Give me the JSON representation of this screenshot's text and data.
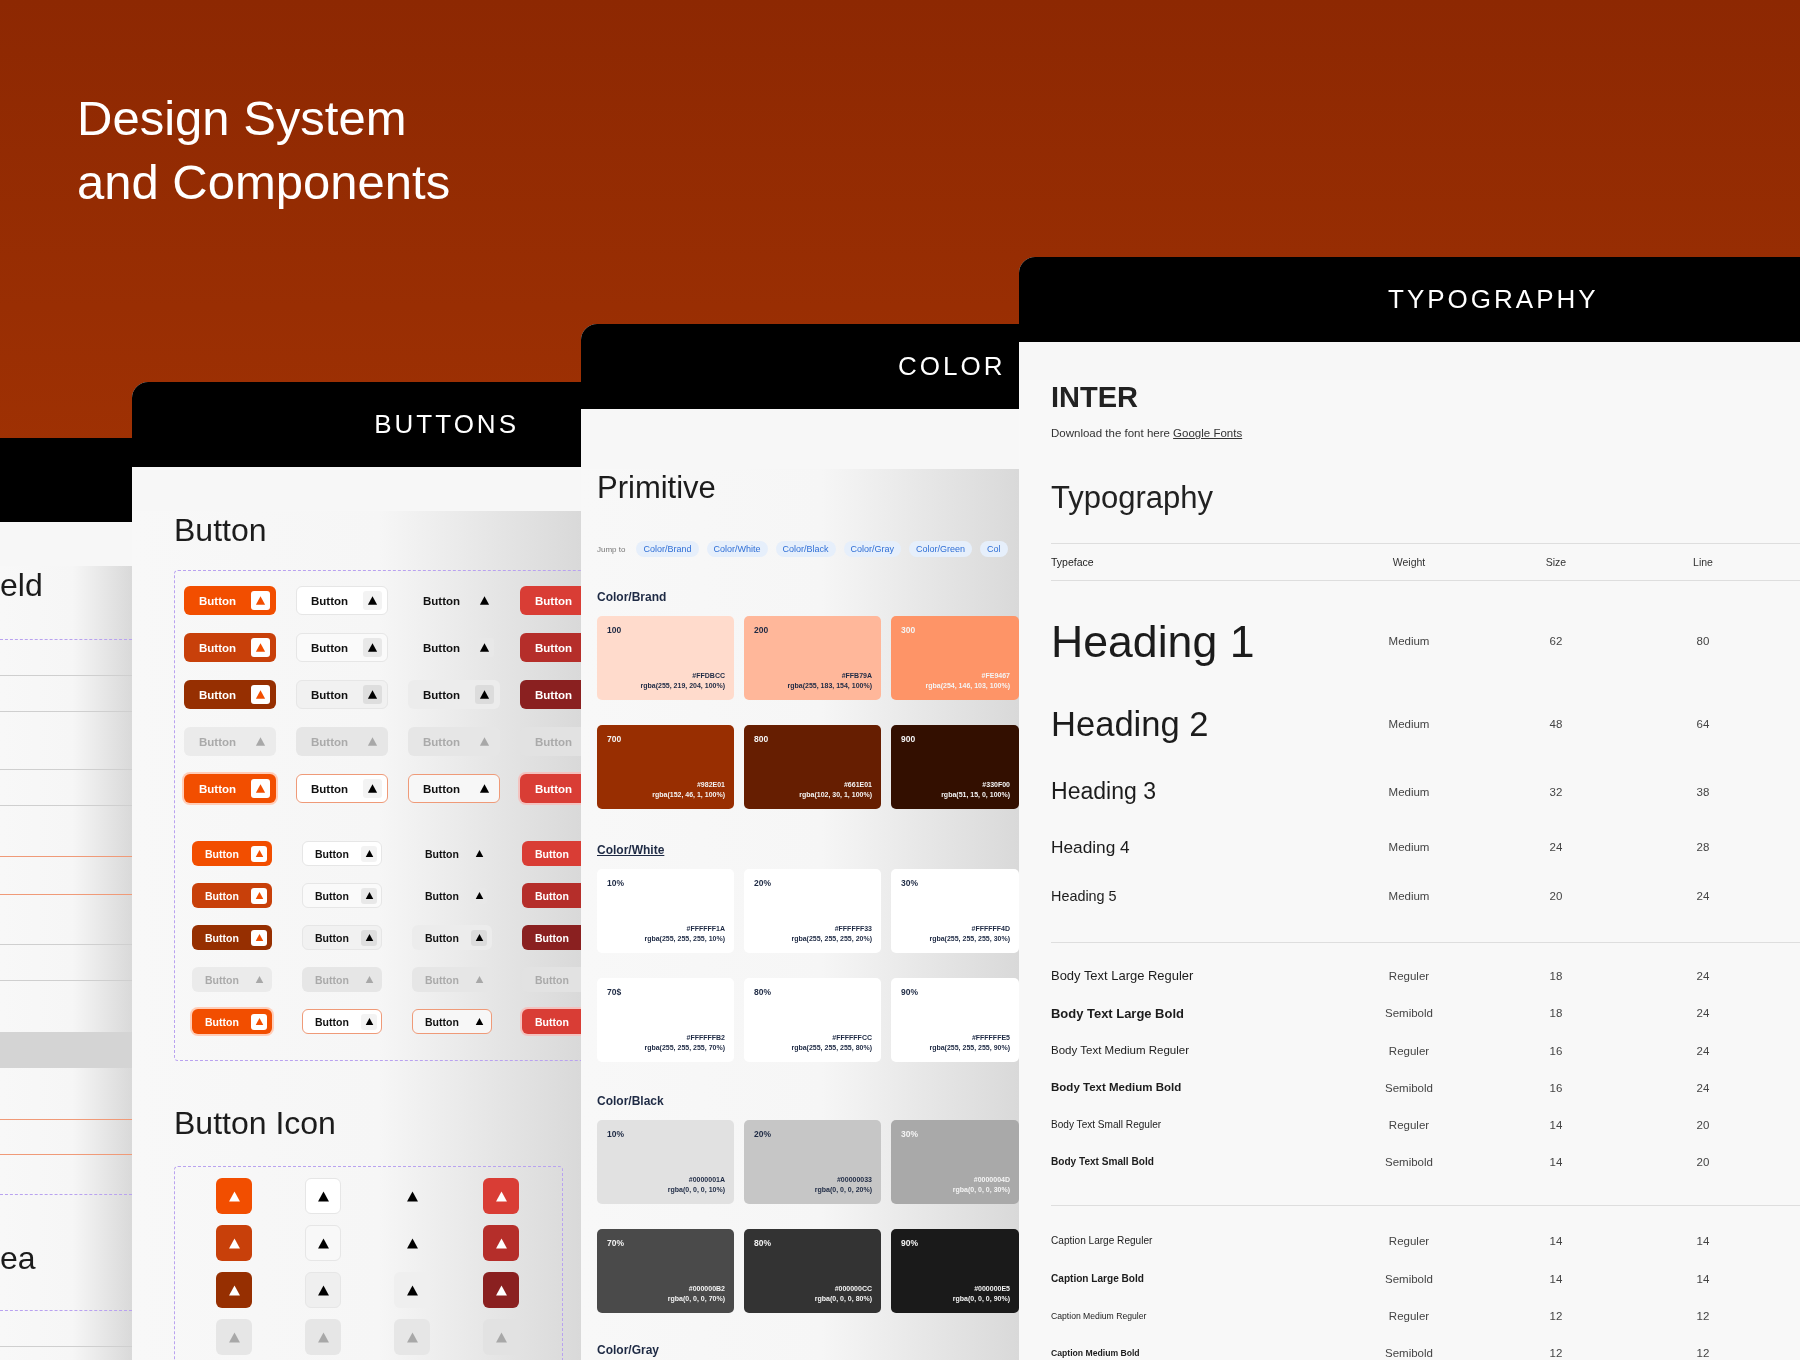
{
  "headline": [
    "Design System",
    "and Components"
  ],
  "field_card": {
    "heading_fragment": "eld",
    "area_fragment": "ea"
  },
  "buttons_card": {
    "title": "BUTTONS",
    "button_heading": "Button",
    "button_sets": [
      {
        "kind": "medium",
        "rows": [
          {
            "kind": "default",
            "buttons": [
              {
                "kind": "primary",
                "label": "Button"
              },
              {
                "kind": "secondary",
                "label": "Button"
              },
              {
                "kind": "tertiary",
                "label": "Button"
              },
              {
                "kind": "danger",
                "label": "Button"
              }
            ]
          },
          {
            "kind": "hover",
            "buttons": [
              {
                "kind": "primary",
                "label": "Button"
              },
              {
                "kind": "secondary",
                "label": "Button"
              },
              {
                "kind": "tertiary",
                "label": "Button"
              },
              {
                "kind": "danger",
                "label": "Button"
              }
            ]
          },
          {
            "kind": "pressed",
            "buttons": [
              {
                "kind": "primary",
                "label": "Button"
              },
              {
                "kind": "secondary",
                "label": "Button"
              },
              {
                "kind": "tertiary",
                "label": "Button"
              },
              {
                "kind": "danger",
                "label": "Button"
              }
            ]
          },
          {
            "kind": "disabled",
            "buttons": [
              {
                "kind": "primary",
                "label": "Button"
              },
              {
                "kind": "secondary",
                "label": "Button"
              },
              {
                "kind": "tertiary",
                "label": "Button"
              },
              {
                "kind": "danger",
                "label": "Button"
              }
            ]
          },
          {
            "kind": "focus",
            "buttons": [
              {
                "kind": "primary",
                "label": "Button"
              },
              {
                "kind": "secondary",
                "label": "Button"
              },
              {
                "kind": "tertiary",
                "label": "Button"
              },
              {
                "kind": "danger",
                "label": "Button"
              }
            ]
          }
        ]
      },
      {
        "kind": "small",
        "rows": [
          {
            "kind": "default",
            "buttons": [
              {
                "kind": "primary",
                "label": "Button"
              },
              {
                "kind": "secondary",
                "label": "Button"
              },
              {
                "kind": "tertiary",
                "label": "Button"
              },
              {
                "kind": "danger",
                "label": "Button"
              }
            ]
          },
          {
            "kind": "hover",
            "buttons": [
              {
                "kind": "primary",
                "label": "Button"
              },
              {
                "kind": "secondary",
                "label": "Button"
              },
              {
                "kind": "tertiary",
                "label": "Button"
              },
              {
                "kind": "danger",
                "label": "Button"
              }
            ]
          },
          {
            "kind": "pressed",
            "buttons": [
              {
                "kind": "primary",
                "label": "Button"
              },
              {
                "kind": "secondary",
                "label": "Button"
              },
              {
                "kind": "tertiary",
                "label": "Button"
              },
              {
                "kind": "danger",
                "label": "Button"
              }
            ]
          },
          {
            "kind": "disabled",
            "buttons": [
              {
                "kind": "primary",
                "label": "Button"
              },
              {
                "kind": "secondary",
                "label": "Button"
              },
              {
                "kind": "tertiary",
                "label": "Button"
              },
              {
                "kind": "danger",
                "label": "Button"
              }
            ]
          },
          {
            "kind": "focus",
            "buttons": [
              {
                "kind": "primary",
                "label": "Button"
              },
              {
                "kind": "secondary",
                "label": "Button"
              },
              {
                "kind": "tertiary",
                "label": "Button"
              },
              {
                "kind": "danger",
                "label": "Button"
              }
            ]
          }
        ]
      }
    ],
    "icon_heading": "Button Icon",
    "icon_rows": [
      {
        "kind": "default",
        "buttons": [
          {
            "kind": "primary"
          },
          {
            "kind": "secondary"
          },
          {
            "kind": "tertiary"
          },
          {
            "kind": "danger"
          }
        ]
      },
      {
        "kind": "hover",
        "buttons": [
          {
            "kind": "primary"
          },
          {
            "kind": "secondary"
          },
          {
            "kind": "tertiary"
          },
          {
            "kind": "danger"
          }
        ]
      },
      {
        "kind": "pressed",
        "buttons": [
          {
            "kind": "primary"
          },
          {
            "kind": "secondary"
          },
          {
            "kind": "tertiary"
          },
          {
            "kind": "danger"
          }
        ]
      },
      {
        "kind": "disabled",
        "buttons": [
          {
            "kind": "primary"
          },
          {
            "kind": "secondary"
          },
          {
            "kind": "tertiary"
          },
          {
            "kind": "danger"
          }
        ]
      }
    ]
  },
  "color_card": {
    "title": "COLOR",
    "heading": "Primitive",
    "jump_label": "Jump to",
    "jump_links": [
      "Color/Brand",
      "Color/White",
      "Color/Black",
      "Color/Gray",
      "Color/Green",
      "Col"
    ],
    "sections": [
      {
        "name": "Color/Brand",
        "underlined": false,
        "swatches": [
          {
            "step": "100",
            "hex": "#FFDBCC",
            "rgba": "rgba(255, 219, 204, 100%)",
            "color": "#ffdbcc"
          },
          {
            "step": "200",
            "hex": "#FFB79A",
            "rgba": "rgba(255, 183, 154, 100%)",
            "color": "#ffb79a"
          },
          {
            "step": "300",
            "hex": "#FE9467",
            "rgba": "rgba(254, 146, 103, 100%)",
            "color": "#fe9467"
          },
          {
            "step": "700",
            "hex": "#982E01",
            "rgba": "rgba(152, 46, 1, 100%)",
            "color": "#982e01"
          },
          {
            "step": "800",
            "hex": "#661E01",
            "rgba": "rgba(102, 30, 1, 100%)",
            "color": "#661e01"
          },
          {
            "step": "900",
            "hex": "#330F00",
            "rgba": "rgba(51, 15, 0, 100%)",
            "color": "#330f00"
          }
        ]
      },
      {
        "name": "Color/White",
        "underlined": true,
        "swatches": [
          {
            "step": "10%",
            "hex": "#FFFFFF1A",
            "rgba": "rgba(255, 255, 255, 10%)",
            "color": "#ffffff"
          },
          {
            "step": "20%",
            "hex": "#FFFFFF33",
            "rgba": "rgba(255, 255, 255, 20%)",
            "color": "#ffffff"
          },
          {
            "step": "30%",
            "hex": "#FFFFFF4D",
            "rgba": "rgba(255, 255, 255, 30%)",
            "color": "#ffffff"
          },
          {
            "step": "70$",
            "hex": "#FFFFFFB2",
            "rgba": "rgba(255, 255, 255, 70%)",
            "color": "#ffffff"
          },
          {
            "step": "80%",
            "hex": "#FFFFFFCC",
            "rgba": "rgba(255, 255, 255, 80%)",
            "color": "#ffffff"
          },
          {
            "step": "90%",
            "hex": "#FFFFFFE5",
            "rgba": "rgba(255, 255, 255, 90%)",
            "color": "#ffffff"
          }
        ]
      },
      {
        "name": "Color/Black",
        "underlined": false,
        "swatches": [
          {
            "step": "10%",
            "hex": "#0000001A",
            "rgba": "rgba(0, 0, 0, 10%)",
            "color": "#e1e1e1"
          },
          {
            "step": "20%",
            "hex": "#00000033",
            "rgba": "rgba(0, 0, 0, 20%)",
            "color": "#c6c6c6"
          },
          {
            "step": "30%",
            "hex": "#0000004D",
            "rgba": "rgba(0, 0, 0, 30%)",
            "color": "#a9a9a9"
          },
          {
            "step": "70%",
            "hex": "#000000B2",
            "rgba": "rgba(0, 0, 0, 70%)",
            "color": "#4a4a4a"
          },
          {
            "step": "80%",
            "hex": "#000000CC",
            "rgba": "rgba(0, 0, 0, 80%)",
            "color": "#333333"
          },
          {
            "step": "90%",
            "hex": "#000000E5",
            "rgba": "rgba(0, 0, 0, 90%)",
            "color": "#1a1a1a"
          }
        ]
      },
      {
        "name": "Color/Gray",
        "underlined": false
      }
    ]
  },
  "type_card": {
    "title": "TYPOGRAPHY",
    "font_name": "INTER",
    "download_text": "Download the font here",
    "download_link": "Google Fonts",
    "heading": "Typography",
    "columns": [
      "Typeface",
      "Weight",
      "Size",
      "Line"
    ],
    "groups": [
      {
        "kind": "heading",
        "rows": [
          {
            "name": "Heading 1",
            "weight": "Medium",
            "size": "62",
            "line": "80",
            "bold": false
          },
          {
            "name": "Heading 2",
            "weight": "Medium",
            "size": "48",
            "line": "64",
            "bold": false
          },
          {
            "name": "Heading 3",
            "weight": "Medium",
            "size": "32",
            "line": "38",
            "bold": false
          },
          {
            "name": "Heading 4",
            "weight": "Medium",
            "size": "24",
            "line": "28",
            "bold": false
          },
          {
            "name": "Heading 5",
            "weight": "Medium",
            "size": "20",
            "line": "24",
            "bold": false
          }
        ]
      },
      {
        "kind": "body",
        "rows": [
          {
            "name": "Body Text Large Reguler",
            "weight": "Reguler",
            "size": "18",
            "line": "24",
            "bold": false
          },
          {
            "name": "Body Text Large Bold",
            "weight": "Semibold",
            "size": "18",
            "line": "24",
            "bold": true
          },
          {
            "name": "Body Text Medium Reguler",
            "weight": "Reguler",
            "size": "16",
            "line": "24",
            "bold": false
          },
          {
            "name": "Body Text Medium Bold",
            "weight": "Semibold",
            "size": "16",
            "line": "24",
            "bold": true
          },
          {
            "name": "Body Text Small Reguler",
            "weight": "Reguler",
            "size": "14",
            "line": "20",
            "bold": false
          },
          {
            "name": "Body Text Small Bold",
            "weight": "Semibold",
            "size": "14",
            "line": "20",
            "bold": true
          }
        ]
      },
      {
        "kind": "caption",
        "rows": [
          {
            "name": "Caption Large Reguler",
            "weight": "Reguler",
            "size": "14",
            "line": "14",
            "bold": false
          },
          {
            "name": "Caption Large Bold",
            "weight": "Semibold",
            "size": "14",
            "line": "14",
            "bold": true
          },
          {
            "name": "Caption Medium Reguler",
            "weight": "Reguler",
            "size": "12",
            "line": "12",
            "bold": false
          },
          {
            "name": "Caption Medium Bold",
            "weight": "Semibold",
            "size": "12",
            "line": "12",
            "bold": true
          }
        ]
      }
    ]
  }
}
